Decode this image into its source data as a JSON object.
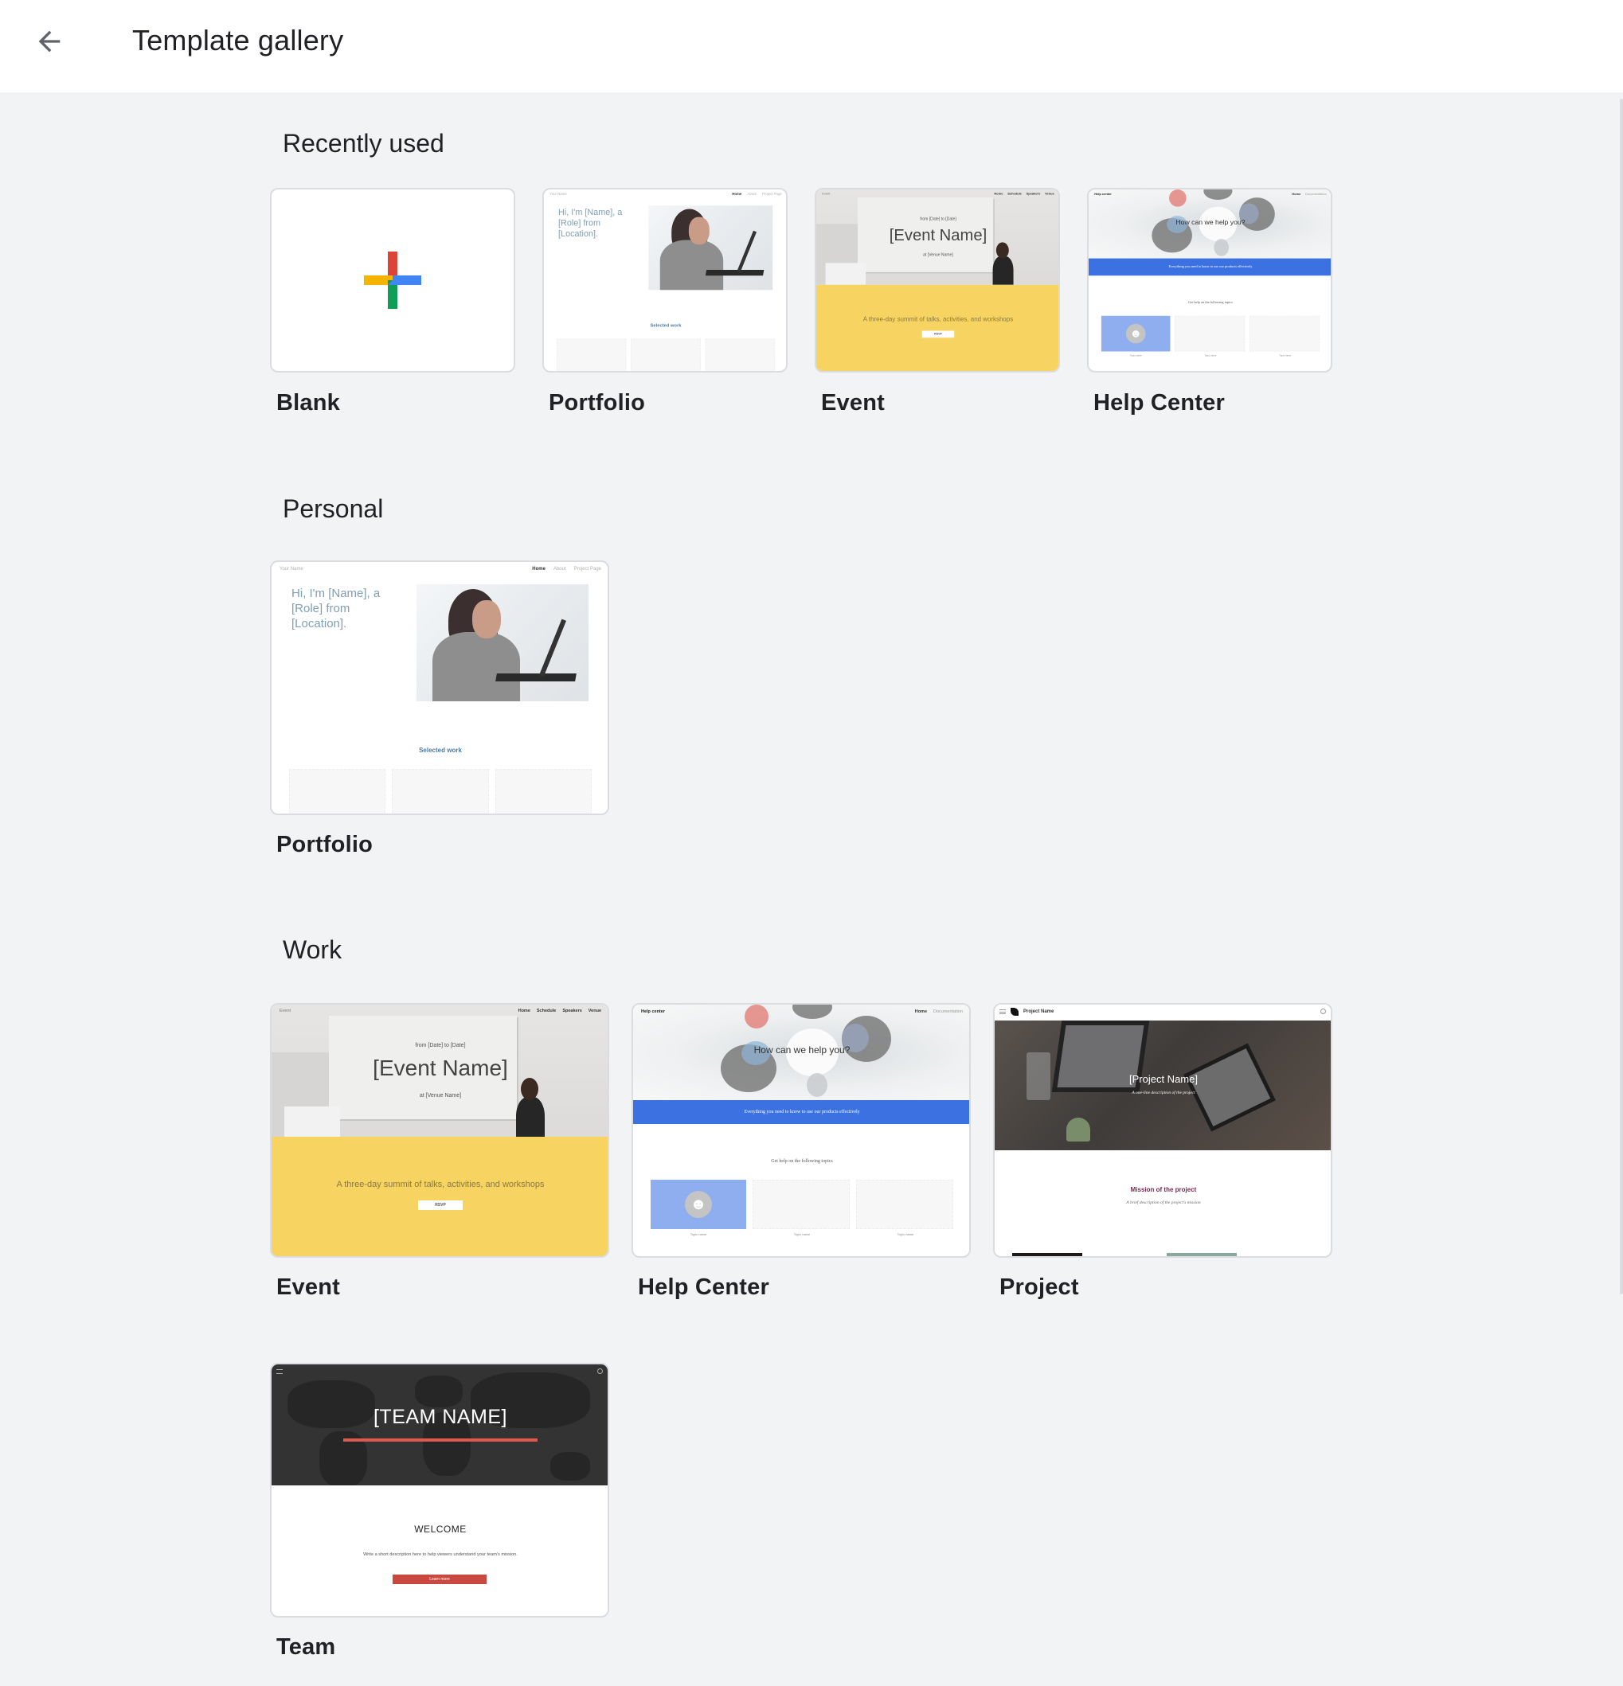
{
  "header": {
    "back_icon": "arrow-back-icon",
    "title": "Template gallery"
  },
  "sections": [
    {
      "title": "Recently used",
      "templates": [
        {
          "label": "Blank",
          "preview": "blank"
        },
        {
          "label": "Portfolio",
          "preview": "portfolio"
        },
        {
          "label": "Event",
          "preview": "event"
        },
        {
          "label": "Help Center",
          "preview": "help-center"
        }
      ]
    },
    {
      "title": "Personal",
      "templates": [
        {
          "label": "Portfolio",
          "preview": "portfolio"
        }
      ]
    },
    {
      "title": "Work",
      "templates": [
        {
          "label": "Event",
          "preview": "event"
        },
        {
          "label": "Help Center",
          "preview": "help-center"
        },
        {
          "label": "Project",
          "preview": "project"
        },
        {
          "label": "Team",
          "preview": "team"
        }
      ]
    }
  ],
  "previews": {
    "blank": {
      "icon": "plus-icon",
      "colors": {
        "red": "#db4437",
        "blue": "#4285f4",
        "green": "#0f9d58",
        "yellow": "#f4b400"
      }
    },
    "portfolio": {
      "brand": "Your Name",
      "nav": [
        "Home",
        "About",
        "Project Page"
      ],
      "headline": "Hi, I'm [Name], a [Role] from [Location].",
      "section": "Selected work"
    },
    "event": {
      "brand": "Event",
      "nav": [
        "Home",
        "Schedule",
        "Speakers",
        "Venue"
      ],
      "dates": "from [Date] to [Date]",
      "name": "[Event Name]",
      "venue": "at [Venue Name]",
      "tagline": "A three-day summit of talks, activities, and workshops",
      "cta": "RSVP",
      "accent": "#f7d462"
    },
    "help_center": {
      "brand": "Help center",
      "nav": [
        "Home",
        "Documentation"
      ],
      "question": "How can we help you?",
      "band": "Everything you need to know to use our products effectively",
      "topics_heading": "Get help on the following topics",
      "topic_caption": "Topic name",
      "accent": "#3b71e0"
    },
    "project": {
      "brand": "Project Name",
      "title": "[Project Name]",
      "subtitle": "A one-line description of the project",
      "mission": "Mission of the project",
      "mission_desc": "A brief description of the project's mission",
      "accent": "#7b2750"
    },
    "team": {
      "title": "[TEAM NAME]",
      "welcome": "WELCOME",
      "description": "Write a short description here to help viewers understand your team's mission.",
      "cta": "Learn more",
      "accent": "#c9483f"
    }
  },
  "colors": {
    "background": "#f1f3f4",
    "header": "#ffffff",
    "text": "#202124",
    "card_border": "#dadce0"
  }
}
